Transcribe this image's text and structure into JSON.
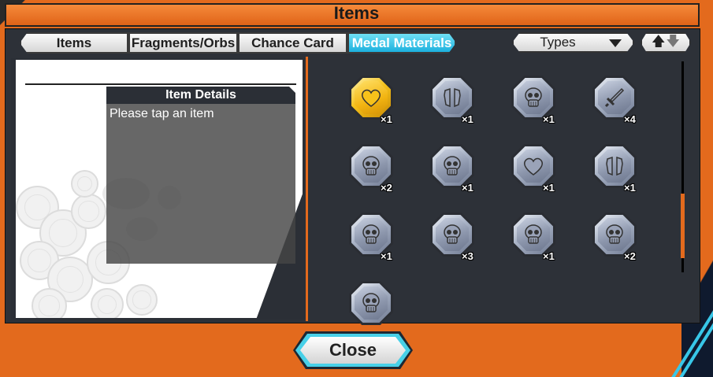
{
  "window": {
    "title": "Items"
  },
  "tabs": [
    {
      "label": "Items",
      "active": false
    },
    {
      "label": "Fragments/Orbs",
      "active": false
    },
    {
      "label": "Chance Card",
      "active": false
    },
    {
      "label": "Medal Materials",
      "active": true
    }
  ],
  "filter": {
    "label": "Types",
    "icon": "triangle-down-icon"
  },
  "sort": {
    "icon": "sort-up-down-arrows-icon",
    "up_glyph": "🡅",
    "down_glyph": "🡇"
  },
  "details": {
    "header": "Item Details",
    "text": "Please tap an item"
  },
  "medals": [
    {
      "icon": "heart-icon",
      "tier": "gold",
      "count": "×1"
    },
    {
      "icon": "armor-icon",
      "tier": "silver",
      "count": "×1"
    },
    {
      "icon": "skull-icon",
      "tier": "silver",
      "count": "×1"
    },
    {
      "icon": "sword-icon",
      "tier": "silver",
      "count": "×4"
    },
    {
      "icon": "skull-icon",
      "tier": "silver",
      "count": "×2"
    },
    {
      "icon": "skull-icon",
      "tier": "silver",
      "count": "×1"
    },
    {
      "icon": "heart-icon",
      "tier": "silver",
      "count": "×1"
    },
    {
      "icon": "armor-icon",
      "tier": "silver",
      "count": "×1"
    },
    {
      "icon": "skull-icon",
      "tier": "silver",
      "count": "×1"
    },
    {
      "icon": "skull-icon",
      "tier": "silver",
      "count": "×3"
    },
    {
      "icon": "skull-icon",
      "tier": "silver",
      "count": "×1"
    },
    {
      "icon": "skull-icon",
      "tier": "silver",
      "count": "×2"
    },
    {
      "icon": "skull-icon",
      "tier": "silver",
      "count": ""
    }
  ],
  "close_button": {
    "label": "Close"
  },
  "colors": {
    "frame": "#e36a1d",
    "active_tab": "#1cb0de",
    "panel": "#2d3138"
  }
}
